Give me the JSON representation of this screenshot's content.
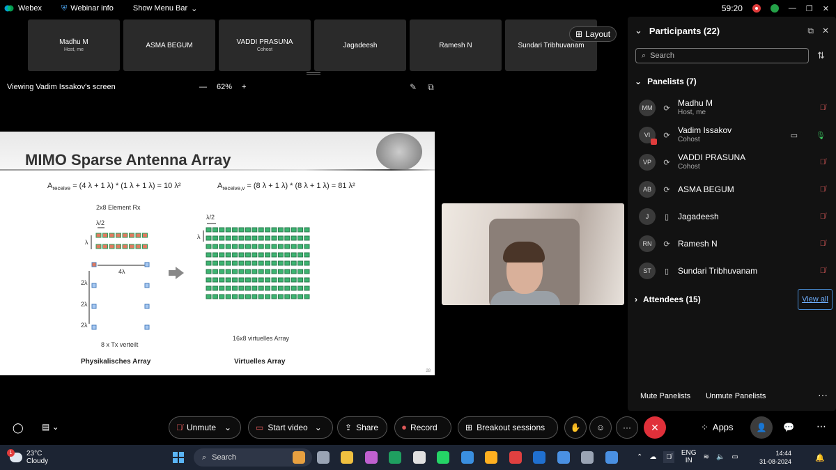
{
  "titlebar": {
    "app_name": "Webex",
    "webinar_info": "Webinar info",
    "menu_bar": "Show Menu Bar",
    "timer": "59:20"
  },
  "thumbnails": [
    {
      "name": "Madhu M",
      "sub": "Host, me"
    },
    {
      "name": "ASMA BEGUM",
      "sub": ""
    },
    {
      "name": "VADDI PRASUNA",
      "sub": "Cohost"
    },
    {
      "name": "Jagadeesh",
      "sub": ""
    },
    {
      "name": "Ramesh N",
      "sub": ""
    },
    {
      "name": "Sundari Tribhuvanam",
      "sub": ""
    }
  ],
  "layout_label": "Layout",
  "viewing": {
    "text": "Viewing Vadim Issakov's screen",
    "zoom": "62%",
    "minus": "—",
    "plus": "+"
  },
  "slide": {
    "title": "MIMO Sparse Antenna Array",
    "formula_left_a": "A",
    "formula_left_sub": "receive",
    "formula_left_rest": " = (4 λ + 1 λ) * (1 λ + 1 λ) = 10 λ²",
    "formula_right_a": "A",
    "formula_right_sub": "receive,v",
    "formula_right_rest": " = (8 λ + 1 λ) * (8 λ + 1 λ) = 81 λ²",
    "rx_caption": "2x8 Element Rx",
    "half_lambda": "λ/2",
    "lambda": "λ",
    "four_lambda": "4λ",
    "two_lambda": "2λ",
    "tx_caption": "8 x Tx verteilt",
    "virtual_caption": "16x8 virtuelles Array",
    "physical_label": "Physikalisches Array",
    "virtual_label": "Virtuelles Array",
    "slide_number": "28"
  },
  "participants": {
    "title": "Participants (22)",
    "search_placeholder": "Search",
    "panelists_label": "Panelists (7)",
    "attendees_label": "Attendees (15)",
    "view_all": "View all",
    "mute_panelists": "Mute Panelists",
    "unmute_panelists": "Unmute Panelists",
    "more": "···",
    "panelists": [
      {
        "initials": "MM",
        "name": "Madhu M",
        "role": "Host, me",
        "mic": "muted",
        "device": "sync"
      },
      {
        "initials": "VI",
        "name": "Vadim Issakov",
        "role": "Cohost",
        "mic": "on",
        "device": "sync"
      },
      {
        "initials": "VP",
        "name": "VADDI PRASUNA",
        "role": "Cohost",
        "mic": "muted",
        "device": "sync"
      },
      {
        "initials": "AB",
        "name": "ASMA BEGUM",
        "role": "",
        "mic": "muted",
        "device": "sync"
      },
      {
        "initials": "J",
        "name": "Jagadeesh",
        "role": "",
        "mic": "muted",
        "device": "phone"
      },
      {
        "initials": "RN",
        "name": "Ramesh N",
        "role": "",
        "mic": "muted",
        "device": "sync"
      },
      {
        "initials": "ST",
        "name": "Sundari Tribhuvanam",
        "role": "",
        "mic": "muted",
        "device": "phone"
      }
    ]
  },
  "toolbar": {
    "unmute": "Unmute",
    "start_video": "Start video",
    "share": "Share",
    "record": "Record",
    "breakout": "Breakout sessions",
    "apps": "Apps",
    "more": "···"
  },
  "taskbar": {
    "temp": "23°C",
    "weather": "Cloudy",
    "weather_badge": "1",
    "search": "Search",
    "lang1": "ENG",
    "lang2": "IN",
    "time": "14:44",
    "date": "31-08-2024"
  }
}
